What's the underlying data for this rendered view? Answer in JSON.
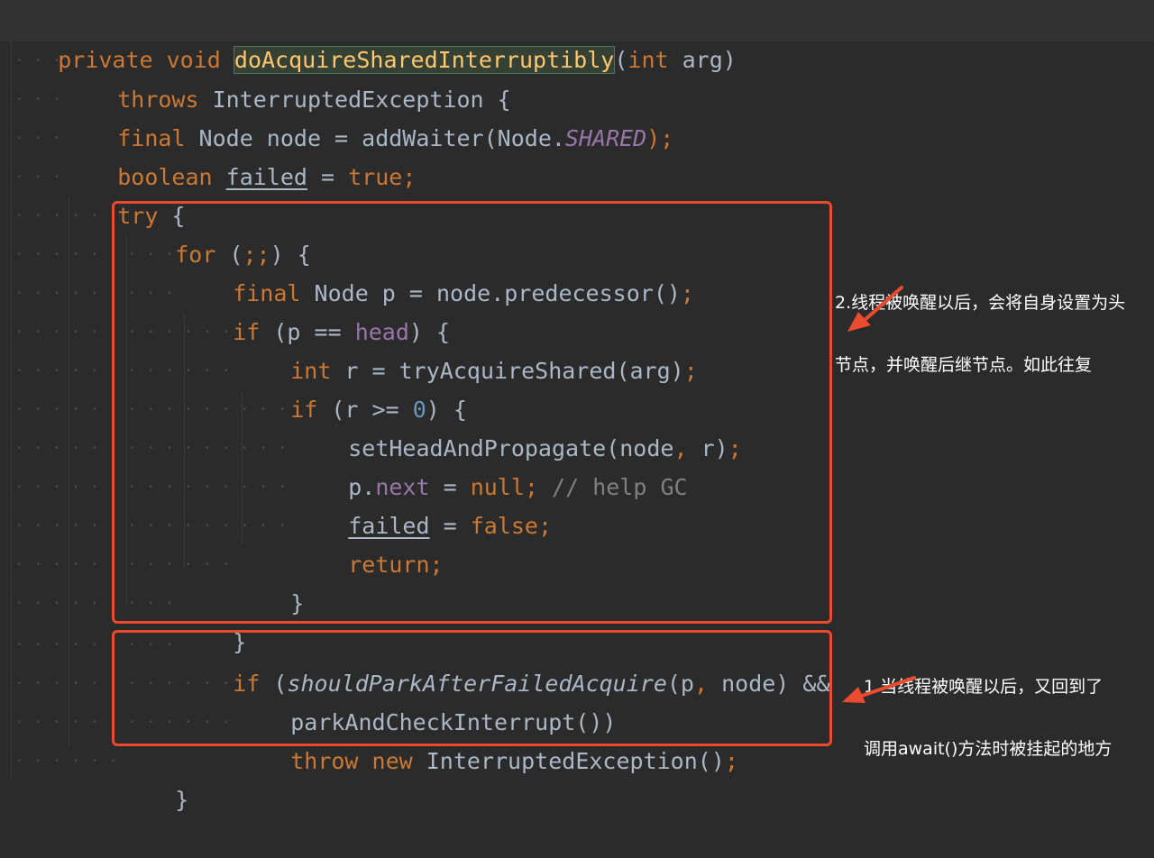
{
  "code": {
    "line1": {
      "p1": "private void ",
      "p2": "doAcquireSharedInterruptibly",
      "p3": "(",
      "p4": "int",
      "p5": " arg)"
    },
    "line2": {
      "p1": "throws",
      "p2": " InterruptedException {"
    },
    "line3": {
      "p1": "final",
      "p2": " Node node = addWaiter(Node.",
      "p3": "SHARED",
      "p4": ");"
    },
    "line4": {
      "p1": "boolean",
      "p2": " ",
      "p3": "failed",
      "p4": " = ",
      "p5": "true",
      "p6": ";"
    },
    "line5": {
      "p1": "try",
      "p2": " {"
    },
    "line6": {
      "p1": "for",
      "p2": " (",
      "p3": ";;",
      "p4": ") {"
    },
    "line7": {
      "p1": "final",
      "p2": " Node p = node.predecessor()",
      "p3": ";"
    },
    "line8": {
      "p1": "if",
      "p2": " (p == ",
      "p3": "head",
      "p4": ") {"
    },
    "line9": {
      "p1": "int",
      "p2": " r = tryAcquireShared(arg)",
      "p3": ";"
    },
    "line10": {
      "p1": "if",
      "p2": " (r >= ",
      "p3": "0",
      "p4": ") {"
    },
    "line11": {
      "p1": "setHeadAndPropagate(node",
      "p2": ",",
      "p3": " r)",
      "p4": ";"
    },
    "line12": {
      "p1": "p.",
      "p2": "next",
      "p3": " = ",
      "p4": "null",
      "p5": ";",
      "p6": " // help GC"
    },
    "line13": {
      "p1": "failed",
      "p2": " = ",
      "p3": "false",
      "p4": ";"
    },
    "line14": {
      "p1": "return",
      "p2": ";"
    },
    "line15": {
      "p1": "}"
    },
    "line16": {
      "p1": "}"
    },
    "line17": {
      "p1": "if",
      "p2": " (",
      "p3": "shouldParkAfterFailedAcquire",
      "p4": "(p",
      "p5": ",",
      "p6": " node) &&"
    },
    "line18": {
      "p1": "parkAndCheckInterrupt())"
    },
    "line19": {
      "p1": "throw",
      "p2": " ",
      "p3": "new",
      "p4": " InterruptedException()",
      "p5": ";"
    },
    "line20": {
      "p1": "}"
    }
  },
  "annotations": {
    "note2_line1": "2.线程被唤醒以后，会将自身设置为头",
    "note2_line2": "节点，并唤醒后继节点。如此往复",
    "note1_line1": "1.当线程被唤醒以后，又回到了",
    "note1_line2": "调用await()方法时被挂起的地方"
  },
  "colors": {
    "background": "#2b2b2b",
    "keyword": "#cc7832",
    "text": "#a9b7c6",
    "field": "#9876aa",
    "number": "#6897bb",
    "comment": "#808080",
    "annotation_box": "#ea4b2f"
  }
}
